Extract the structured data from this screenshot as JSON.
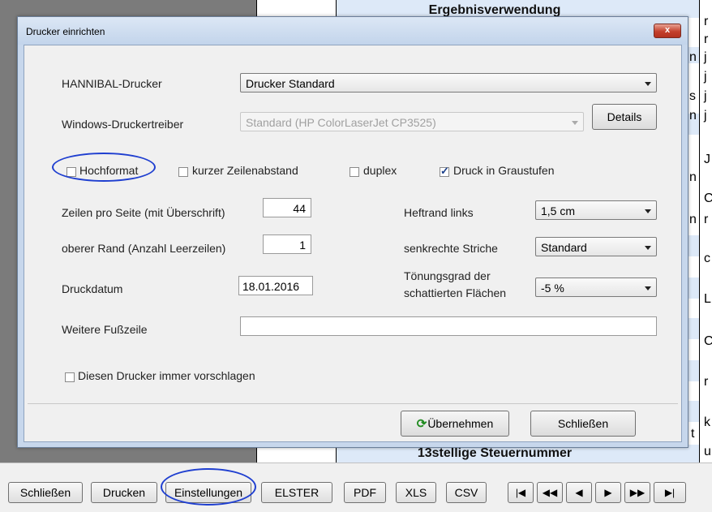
{
  "background": {
    "title_top": "Ergebnisverwendung",
    "title_bottom": "13stellige Steuernummer",
    "right_chars": [
      "r",
      "r",
      "j",
      "j",
      "j",
      "j",
      "J",
      "C",
      "r",
      "c",
      "L",
      "C",
      "r",
      "k",
      "u"
    ],
    "left_chars": [
      "n",
      "s",
      "n",
      "n",
      "n",
      "t"
    ]
  },
  "dialog": {
    "title": "Drucker einrichten",
    "close_label": "x",
    "hannibal_label": "HANNIBAL-Drucker",
    "hannibal_value": "Drucker Standard",
    "windows_label": "Windows-Druckertreiber",
    "windows_value": "Standard  (HP ColorLaserJet CP3525)",
    "details_label": "Details",
    "checkboxes": {
      "hochformat": {
        "label": "Hochformat",
        "checked": false
      },
      "kurzer": {
        "label": "kurzer Zeilenabstand",
        "checked": false
      },
      "duplex": {
        "label": "duplex",
        "checked": false
      },
      "grau": {
        "label": "Druck in Graustufen",
        "checked": true
      }
    },
    "zeilen_label": "Zeilen pro Seite (mit Überschrift)",
    "zeilen_value": "44",
    "rand_label": "oberer Rand (Anzahl Leerzeilen)",
    "rand_value": "1",
    "datum_label": "Druckdatum",
    "datum_value": "18.01.2016",
    "heftrand_label": "Heftrand links",
    "heftrand_value": "1,5 cm",
    "striche_label": "senkrechte Striche",
    "striche_value": "Standard",
    "toenung_label_1": "Tönungsgrad der",
    "toenung_label_2": "schattierten Flächen",
    "toenung_value": "-5 %",
    "fusszeile_label": "Weitere Fußzeile",
    "fusszeile_value": "",
    "vorschlagen_label": "Diesen Drucker immer vorschlagen",
    "vorschlagen_checked": false,
    "uebernehmen_label": "Übernehmen",
    "schliessen_label": "Schließen"
  },
  "toolbar": {
    "schliessen": "Schließen",
    "drucken": "Drucken",
    "einstellungen": "Einstellungen",
    "elster": "ELSTER",
    "pdf": "PDF",
    "xls": "XLS",
    "csv": "CSV",
    "nav_icons": [
      "first-icon",
      "rewind-icon",
      "previous-icon",
      "next-icon",
      "fast-forward-icon",
      "last-icon"
    ]
  },
  "colors": {
    "highlight_circle": "#1f3fd0",
    "close_button": "#c4402c",
    "refresh_icon": "#1e8a1e"
  }
}
